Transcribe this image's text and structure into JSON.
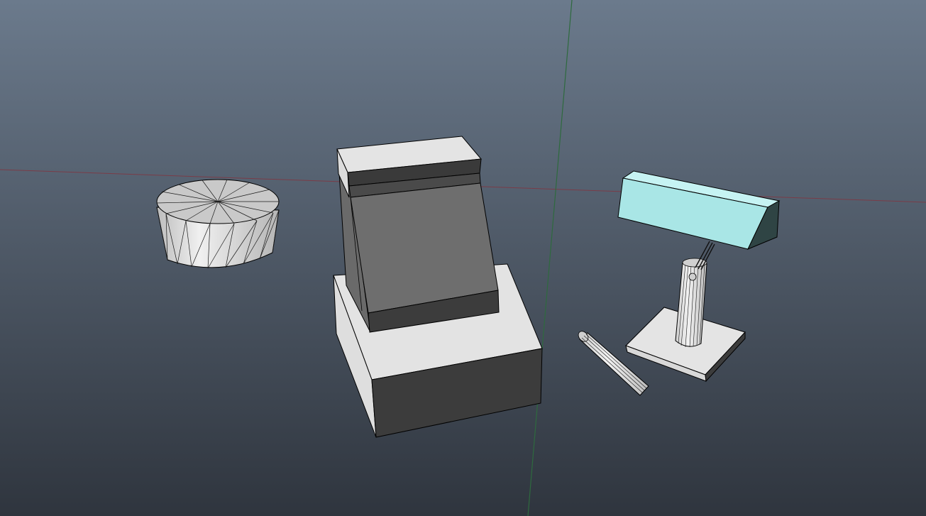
{
  "viewport": {
    "background": {
      "top": "#6b7a8c",
      "bottom": "#2f353e"
    },
    "axes": {
      "x_axis_color": "#7a3c48",
      "z_axis_color": "#2e6a3e"
    }
  },
  "scene": {
    "objects": [
      {
        "id": "cylinder",
        "type": "cylinder-mesh",
        "selected": false,
        "color": "#e0e0e0"
      },
      {
        "id": "monitor",
        "type": "crt-monitor-mesh",
        "selected": false,
        "color": "#e3e3e3"
      },
      {
        "id": "desk-lamp",
        "type": "desk-lamp-mesh",
        "selected": true,
        "selection_color": "#a9e6e6"
      },
      {
        "id": "lamp-arm",
        "type": "cylinder-mesh",
        "selected": false,
        "color": "#e0e0e0"
      }
    ],
    "shading": {
      "light": "#e4e4e4",
      "mid": "#bdbdbd",
      "dark": "#3c3c3c",
      "screen": "#6e6e6e",
      "edge": "#000000"
    }
  }
}
